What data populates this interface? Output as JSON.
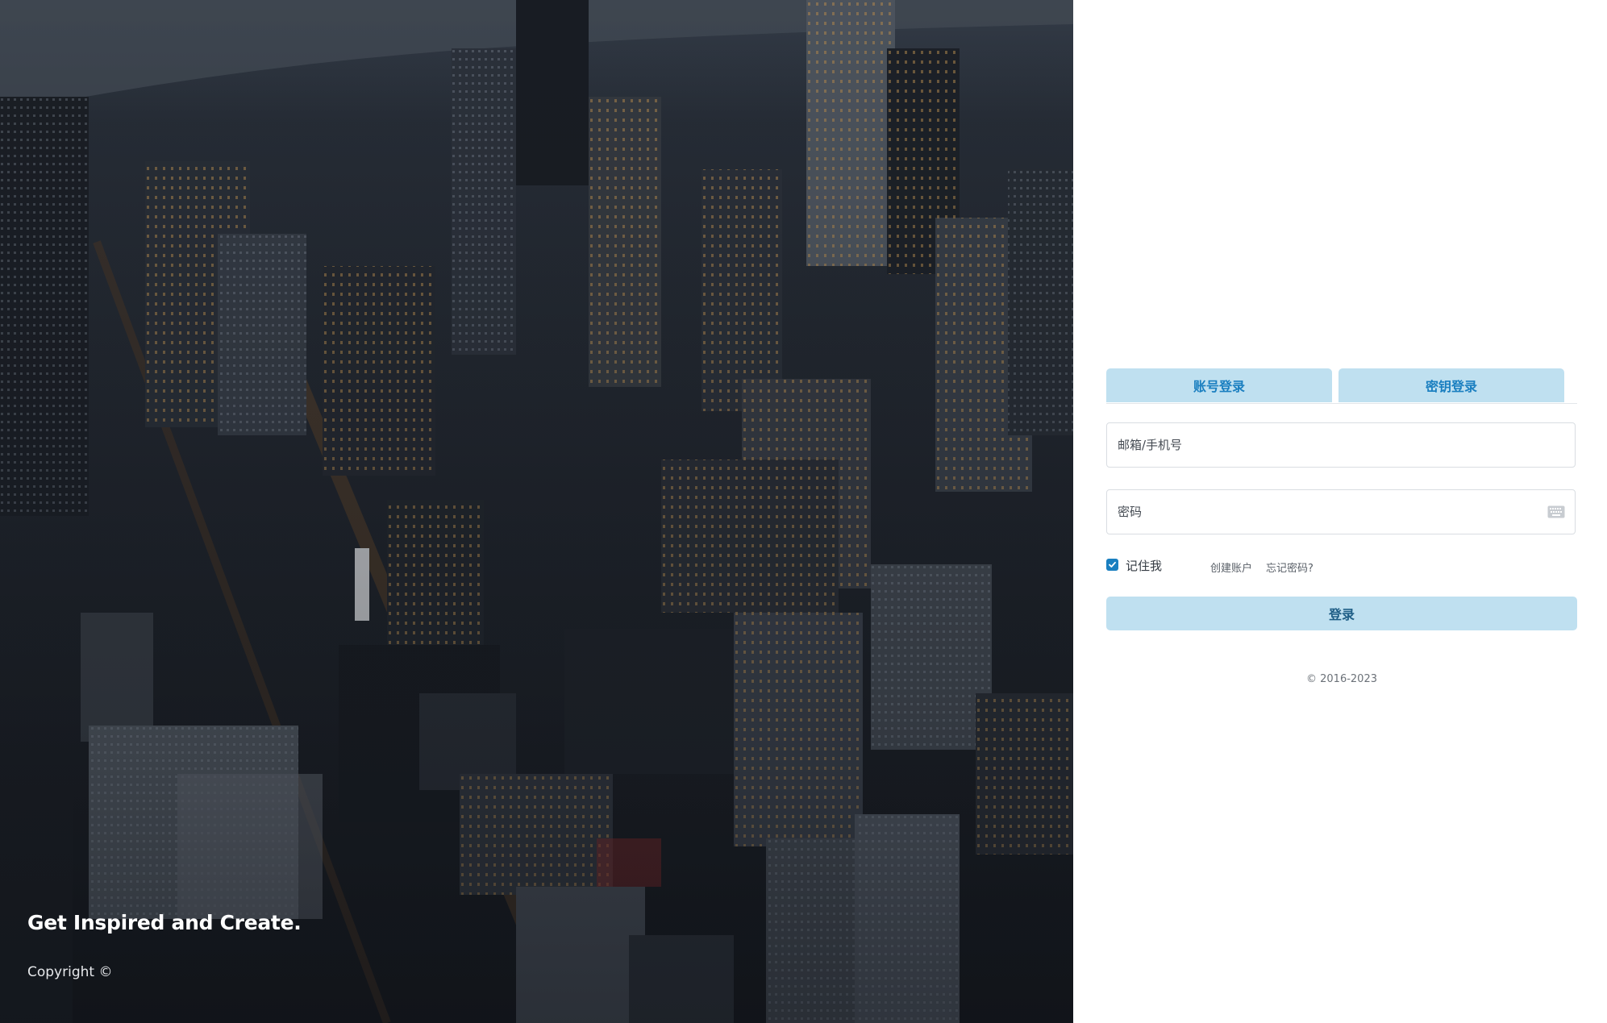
{
  "hero": {
    "tagline": "Get Inspired and Create.",
    "copyright": "Copyright ©",
    "image": "aerial-city-night-photo"
  },
  "login": {
    "tabs": [
      {
        "label": "账号登录",
        "active": true
      },
      {
        "label": "密钥登录",
        "active": false
      }
    ],
    "username": {
      "placeholder": "邮箱/手机号",
      "value": ""
    },
    "password": {
      "placeholder": "密码",
      "value": "",
      "icon": "keyboard-icon"
    },
    "remember": {
      "label": "记住我",
      "checked": true
    },
    "links": {
      "create_account": "创建账户",
      "forgot_password": "忘记密码?"
    },
    "submit_label": "登录",
    "footer": "© 2016-2023"
  },
  "colors": {
    "accent": "#1a7fc0",
    "button_bg": "#bfe0f0",
    "hero_bg": "#1a1e24"
  }
}
